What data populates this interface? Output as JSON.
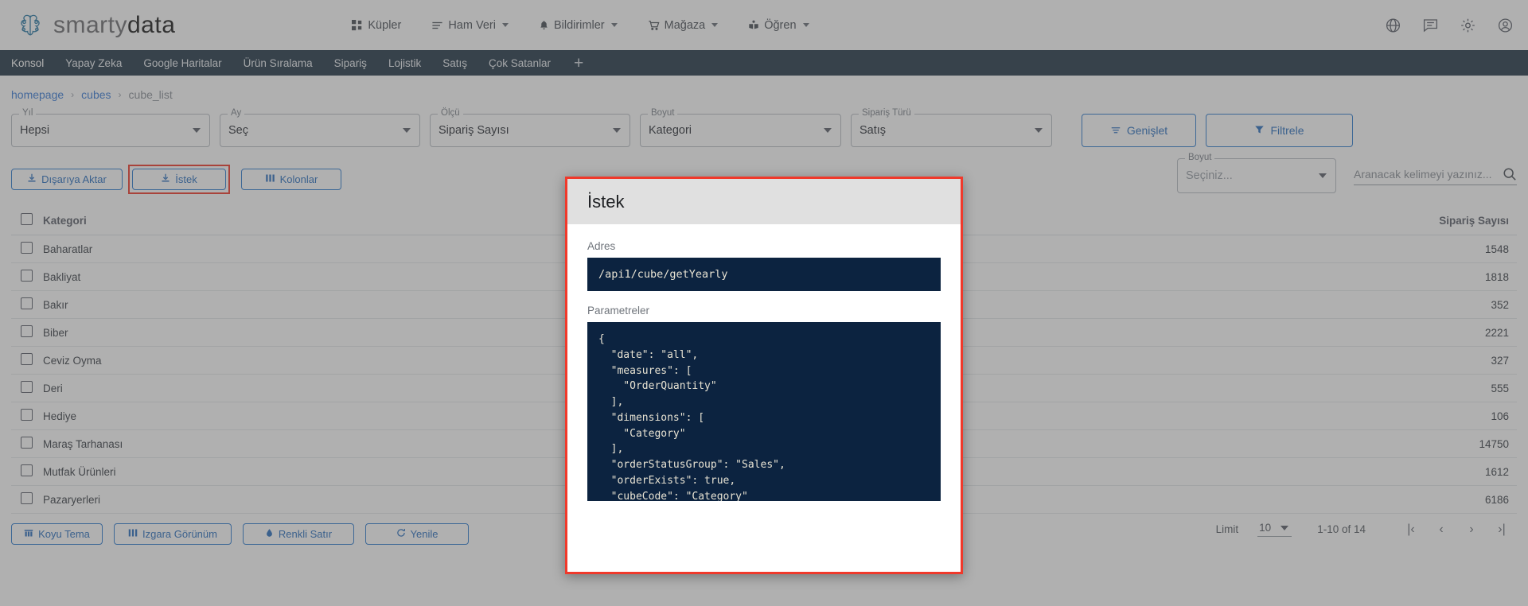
{
  "header": {
    "logo_text_1": "smarty",
    "logo_text_2": "data",
    "nav": [
      {
        "label": "Küpler",
        "icon": "cubes-icon",
        "has_caret": false
      },
      {
        "label": "Ham Veri",
        "icon": "list-icon",
        "has_caret": true
      },
      {
        "label": "Bildirimler",
        "icon": "bell-icon",
        "has_caret": true
      },
      {
        "label": "Mağaza",
        "icon": "cart-icon",
        "has_caret": true
      },
      {
        "label": "Öğren",
        "icon": "book-icon",
        "has_caret": true
      }
    ],
    "icons": [
      "globe-icon",
      "chat-icon",
      "gear-icon",
      "account-icon"
    ]
  },
  "tabs": [
    {
      "label": "Konsol",
      "active": true
    },
    {
      "label": "Yapay Zeka",
      "active": false
    },
    {
      "label": "Google Haritalar",
      "active": false
    },
    {
      "label": "Ürün Sıralama",
      "active": false
    },
    {
      "label": "Sipariş",
      "active": false
    },
    {
      "label": "Lojistik",
      "active": false
    },
    {
      "label": "Satış",
      "active": false
    },
    {
      "label": "Çok Satanlar",
      "active": false
    }
  ],
  "tab_add_label": "+",
  "breadcrumb": {
    "items": [
      "homepage",
      "cubes"
    ],
    "separator": "›",
    "current": "cube_list"
  },
  "filters": [
    {
      "legend": "Yıl",
      "value": "Hepsi",
      "placeholder": false
    },
    {
      "legend": "Ay",
      "value": "Seç",
      "placeholder": false
    },
    {
      "legend": "Ölçü",
      "value": "Sipariş Sayısı",
      "placeholder": false
    },
    {
      "legend": "Boyut",
      "value": "Kategori",
      "placeholder": false
    },
    {
      "legend": "Sipariş Türü",
      "value": "Satış",
      "placeholder": false
    }
  ],
  "filter_buttons": {
    "expand": "Genişlet",
    "filter": "Filtrele"
  },
  "toolbar": {
    "export_label": "Dışarıya Aktar",
    "request_label": "İstek",
    "columns_label": "Kolonlar",
    "dimension_legend": "Boyut",
    "dimension_value": "Seçiniz...",
    "search_placeholder": "Aranacak kelimeyi yazınız..."
  },
  "table": {
    "columns": [
      "Kategori",
      "Sipariş Sayısı"
    ],
    "rows": [
      {
        "name": "Baharatlar",
        "value": "1548"
      },
      {
        "name": "Bakliyat",
        "value": "1818"
      },
      {
        "name": "Bakır",
        "value": "352"
      },
      {
        "name": "Biber",
        "value": "2221"
      },
      {
        "name": "Ceviz Oyma",
        "value": "327"
      },
      {
        "name": "Deri",
        "value": "555"
      },
      {
        "name": "Hediye",
        "value": "106"
      },
      {
        "name": "Maraş Tarhanası",
        "value": "14750"
      },
      {
        "name": "Mutfak Ürünleri",
        "value": "1612"
      },
      {
        "name": "Pazaryerleri",
        "value": "6186"
      }
    ]
  },
  "footer": {
    "dark_theme": "Koyu Tema",
    "grid_view": "Izgara Görünüm",
    "colored_row": "Renkli Satır",
    "refresh": "Yenile"
  },
  "pagination": {
    "limit_label": "Limit",
    "limit_value": "10",
    "range": "1-10 of 14",
    "first": "|‹",
    "prev": "‹",
    "next": "›",
    "last": "›|"
  },
  "modal": {
    "title": "İstek",
    "address_label": "Adres",
    "address_value": "/api1/cube/getYearly",
    "params_label": "Parametreler",
    "params_value": "{\n  \"date\": \"all\",\n  \"measures\": [\n    \"OrderQuantity\"\n  ],\n  \"dimensions\": [\n    \"Category\"\n  ],\n  \"orderStatusGroup\": \"Sales\",\n  \"orderExists\": true,\n  \"cubeCode\": \"Category\"\n}"
  },
  "colors": {
    "accent_blue": "#2a6fbf",
    "tabstrip": "#243748",
    "highlight_red": "#f0392b",
    "code_bg": "#0c2340"
  }
}
